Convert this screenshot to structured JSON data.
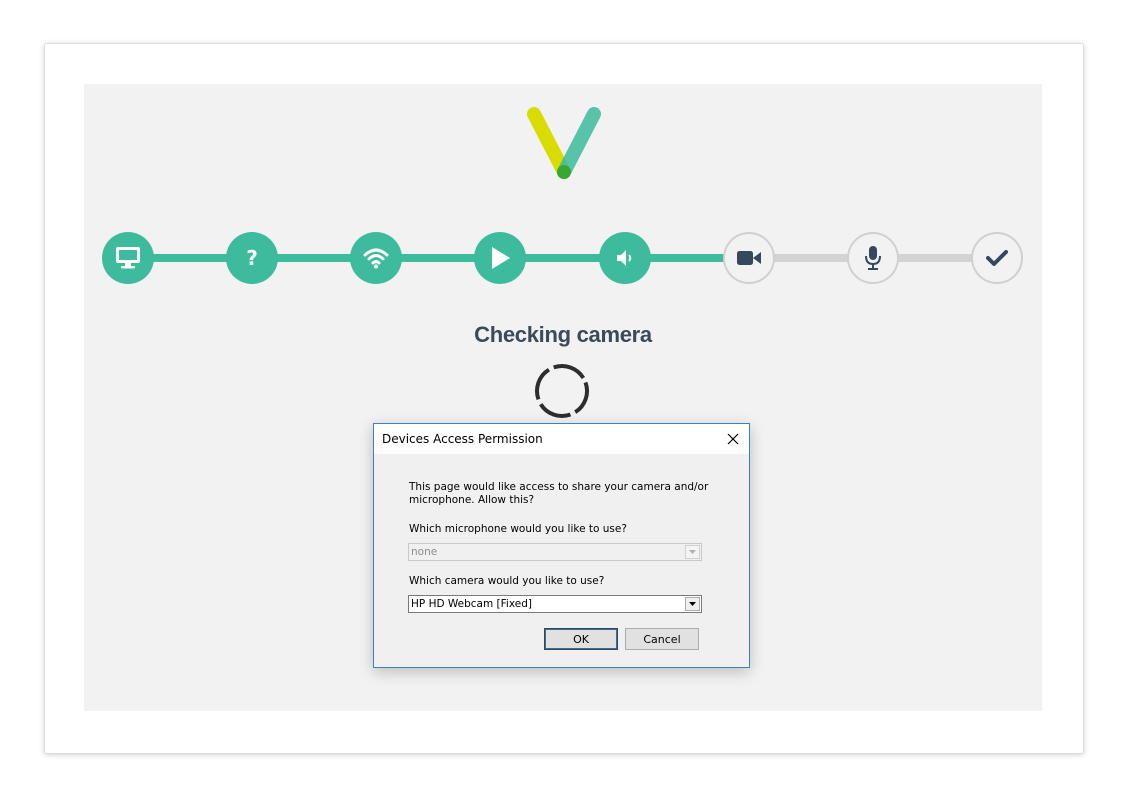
{
  "wizard": {
    "steps": [
      {
        "icon": "monitor-icon",
        "state": "done"
      },
      {
        "icon": "question-icon",
        "state": "done"
      },
      {
        "icon": "wifi-icon",
        "state": "done"
      },
      {
        "icon": "play-icon",
        "state": "done"
      },
      {
        "icon": "speaker-icon",
        "state": "done"
      },
      {
        "icon": "video-camera-icon",
        "state": "active"
      },
      {
        "icon": "microphone-icon",
        "state": "pending"
      },
      {
        "icon": "checkmark-icon",
        "state": "pending"
      }
    ],
    "title": "Checking camera"
  },
  "dialog": {
    "title": "Devices Access Permission",
    "message_line1": "This page would like access to share your camera and/or",
    "message_line2": "microphone. Allow this?",
    "microphone_label": "Which microphone would you like to use?",
    "microphone_value": "none",
    "camera_label": "Which camera would you like to use?",
    "camera_value": "HP HD Webcam [Fixed]",
    "ok_label": "OK",
    "cancel_label": "Cancel"
  },
  "colors": {
    "accent": "#3dbb9c",
    "pending_track": "#d3d3d3",
    "title_text": "#3b4a5a",
    "dialog_border": "#3d7fc4"
  }
}
